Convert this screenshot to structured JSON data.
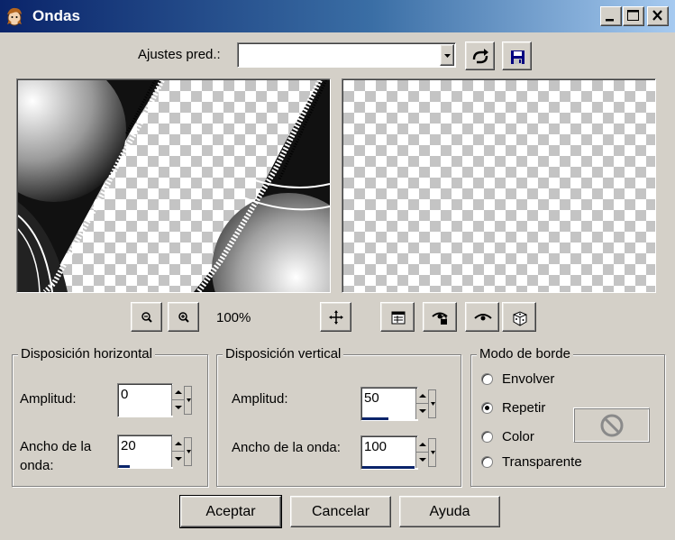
{
  "window": {
    "title": "Ondas"
  },
  "presets": {
    "label": "Ajustes pred.:",
    "value": ""
  },
  "zoom": {
    "level": "100%"
  },
  "horizontal": {
    "legend": "Disposición horizontal",
    "amplitude_label": "Amplitud:",
    "amplitude_value": "0",
    "wavelength_label_line1": "Ancho de la",
    "wavelength_label_line2": "onda:",
    "wavelength_value": "20",
    "amplitude_fraction": 0.0,
    "wavelength_fraction": 0.2
  },
  "vertical": {
    "legend": "Disposición vertical",
    "amplitude_label": "Amplitud:",
    "amplitude_value": "50",
    "wavelength_label": "Ancho de la onda:",
    "wavelength_value": "100",
    "amplitude_fraction": 0.5,
    "wavelength_fraction": 1.0
  },
  "edge_mode": {
    "legend": "Modo de borde",
    "options": [
      "Envolver",
      "Repetir",
      "Color",
      "Transparente"
    ],
    "selected": "Repetir"
  },
  "buttons": {
    "ok": "Aceptar",
    "cancel": "Cancelar",
    "help": "Ayuda"
  },
  "colors": {
    "title_bar": "#0a246a",
    "face": "#d4d0c8",
    "slider_fill": "#0a246a"
  }
}
